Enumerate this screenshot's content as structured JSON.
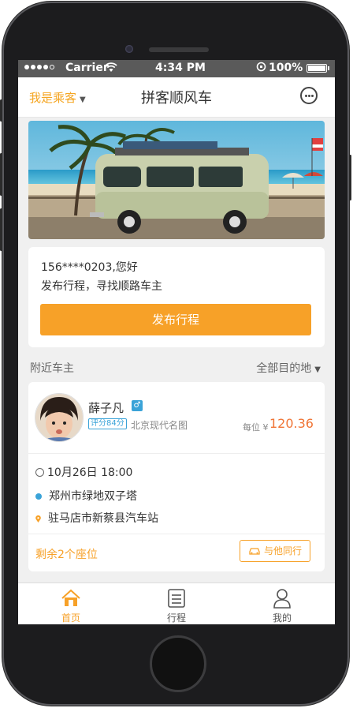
{
  "status_bar": {
    "carrier": "Carrier",
    "time": "4:34 PM",
    "battery": "100%"
  },
  "nav": {
    "role": "我是乘客",
    "title": "拼客顺风车"
  },
  "greeting": {
    "line1": "156****0203,您好",
    "line2": "发布行程，寻找顺路车主",
    "publish_label": "发布行程"
  },
  "section": {
    "left": "附近车主",
    "right": "全部目的地"
  },
  "driver": {
    "name": "薛子凡",
    "gender_symbol": "♂",
    "score": "评分84分",
    "car": "北京现代名图",
    "price_label": "每位 ¥",
    "price": "120.36",
    "datetime": "10月26日 18:00",
    "from": "郑州市绿地双子塔",
    "to": "驻马店市新蔡县汽车站",
    "seats": "剩余2个座位",
    "join_label": "与他同行"
  },
  "tabs": [
    {
      "label": "首页",
      "icon": "home-icon",
      "active": true
    },
    {
      "label": "行程",
      "icon": "itinerary-icon",
      "active": false
    },
    {
      "label": "我的",
      "icon": "user-icon",
      "active": false
    }
  ],
  "colors": {
    "accent": "#f7a128",
    "blue": "#3aa3d8",
    "price": "#f07536"
  }
}
